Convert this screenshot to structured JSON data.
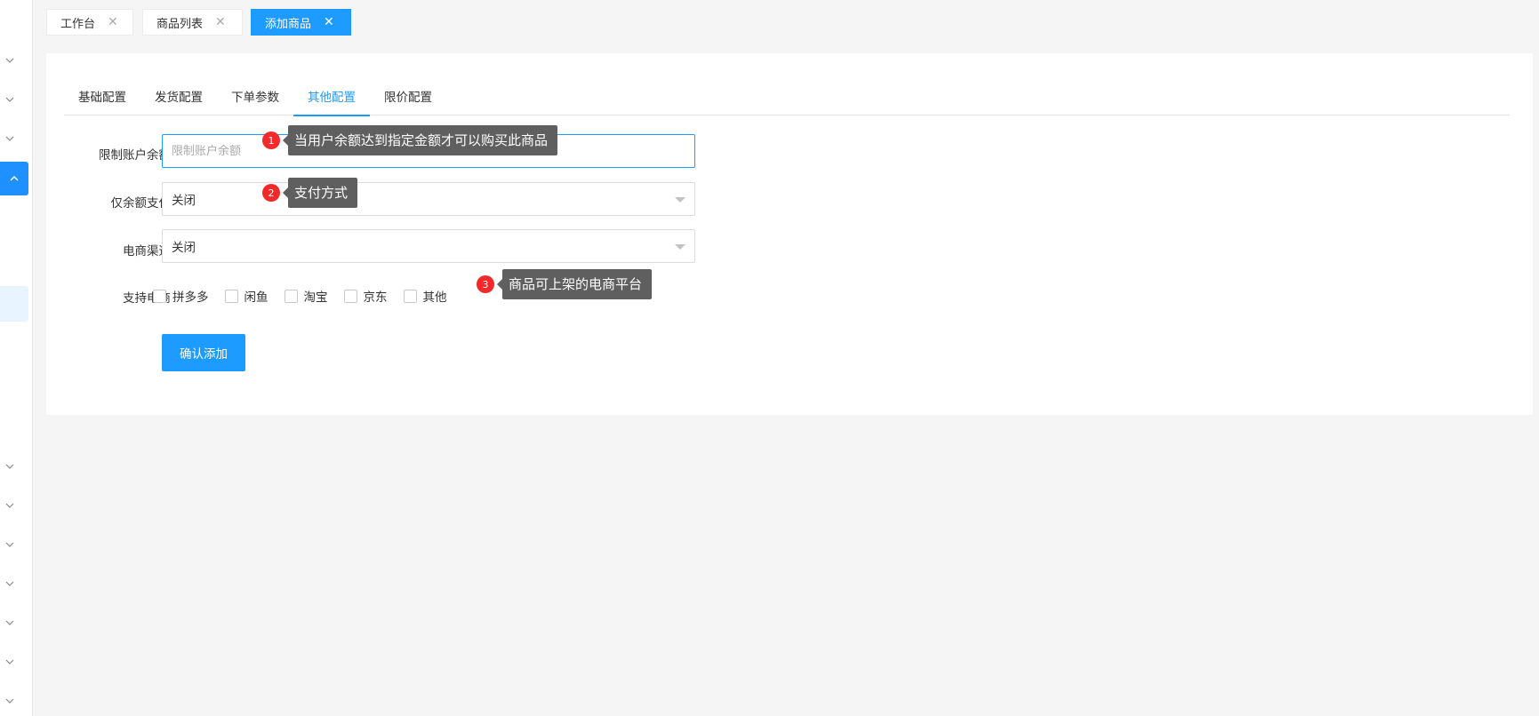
{
  "tags": [
    {
      "label": "工作台",
      "close": "✕"
    },
    {
      "label": "商品列表",
      "close": "✕"
    },
    {
      "label": "添加商品",
      "close": "✕"
    }
  ],
  "tabs": [
    {
      "label": "基础配置"
    },
    {
      "label": "发货配置"
    },
    {
      "label": "下单参数"
    },
    {
      "label": "其他配置"
    },
    {
      "label": "限价配置"
    }
  ],
  "active_tab": "其他配置",
  "form": {
    "balance_limit": {
      "label": "限制账户余额",
      "placeholder": "限制账户余额",
      "value": ""
    },
    "balance_only_pay": {
      "label": "仅余额支付",
      "value": "关闭"
    },
    "ecom_channel": {
      "label": "电商渠道",
      "value": "关闭"
    },
    "supported_ecom": {
      "label": "支持电商",
      "options": [
        {
          "label": "拼多多",
          "checked": false
        },
        {
          "label": "闲鱼",
          "checked": false
        },
        {
          "label": "淘宝",
          "checked": false
        },
        {
          "label": "京东",
          "checked": false
        },
        {
          "label": "其他",
          "checked": false
        }
      ]
    },
    "submit_label": "确认添加"
  },
  "annotations": [
    {
      "num": "1",
      "text": "当用户余额达到指定金额才可以购买此商品"
    },
    {
      "num": "2",
      "text": "支付方式"
    },
    {
      "num": "3",
      "text": "商品可上架的电商平台"
    }
  ],
  "colors": {
    "accent": "#1e9bff",
    "badge": "#f42a2a",
    "tooltip": "#5f5f5f"
  }
}
